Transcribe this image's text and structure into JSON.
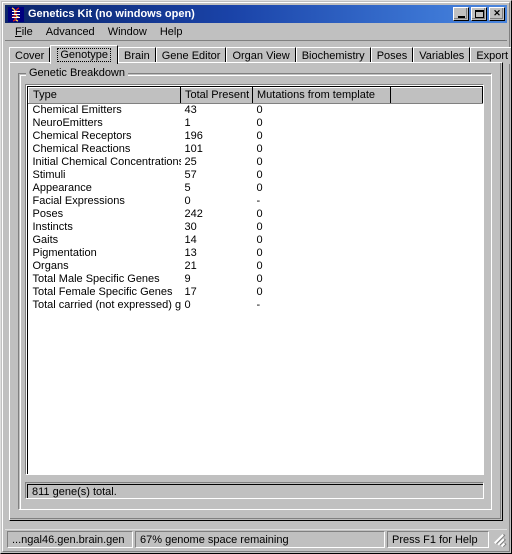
{
  "window": {
    "title": "Genetics Kit (no windows open)",
    "icon": "dna-helix-icon",
    "controls": [
      {
        "name": "minimize-button",
        "label": "_"
      },
      {
        "name": "maximize-button",
        "label": "□"
      },
      {
        "name": "close-button",
        "label": "✕"
      }
    ]
  },
  "menubar": {
    "items": [
      {
        "label": "File",
        "accel": "F"
      },
      {
        "label": "Advanced",
        "accel": ""
      },
      {
        "label": "Window",
        "accel": ""
      },
      {
        "label": "Help",
        "accel": ""
      }
    ]
  },
  "tabs": {
    "selected": "Genotype",
    "items": [
      {
        "label": "Cover"
      },
      {
        "label": "Genotype"
      },
      {
        "label": "Brain"
      },
      {
        "label": "Gene Editor"
      },
      {
        "label": "Organ View"
      },
      {
        "label": "Biochemistry"
      },
      {
        "label": "Poses"
      },
      {
        "label": "Variables"
      },
      {
        "label": "Export"
      }
    ]
  },
  "groupbox": {
    "label": "Genetic Breakdown"
  },
  "table": {
    "columns": [
      "Type",
      "Total Present",
      "Mutations from template",
      ""
    ],
    "rows": [
      [
        "Chemical Emitters",
        "43",
        "0",
        ""
      ],
      [
        "NeuroEmitters",
        "1",
        "0",
        ""
      ],
      [
        "Chemical Receptors",
        "196",
        "0",
        ""
      ],
      [
        "Chemical Reactions",
        "101",
        "0",
        ""
      ],
      [
        "Initial Chemical Concentrations",
        "25",
        "0",
        ""
      ],
      [
        "Stimuli",
        "57",
        "0",
        ""
      ],
      [
        "Appearance",
        "5",
        "0",
        ""
      ],
      [
        "Facial Expressions",
        "0",
        "-",
        ""
      ],
      [
        "Poses",
        "242",
        "0",
        ""
      ],
      [
        "Instincts",
        "30",
        "0",
        ""
      ],
      [
        "Gaits",
        "14",
        "0",
        ""
      ],
      [
        "Pigmentation",
        "13",
        "0",
        ""
      ],
      [
        "Organs",
        "21",
        "0",
        ""
      ],
      [
        "Total Male Specific Genes",
        "9",
        "0",
        ""
      ],
      [
        "Total Female Specific Genes",
        "17",
        "0",
        ""
      ],
      [
        "Total carried (not expressed) g...",
        "0",
        "-",
        ""
      ]
    ]
  },
  "summary": {
    "text": "811 gene(s) total."
  },
  "statusbar": {
    "file": "...ngal46.gen.brain.gen",
    "genome": "67% genome space remaining",
    "help": "Press F1 for Help"
  },
  "colors": {
    "face": "#c0c0c0",
    "title_left": "#0a246a",
    "title_right": "#4b86de",
    "title_text": "#ffffff",
    "list_bg": "#ffffff",
    "text": "#000000"
  }
}
